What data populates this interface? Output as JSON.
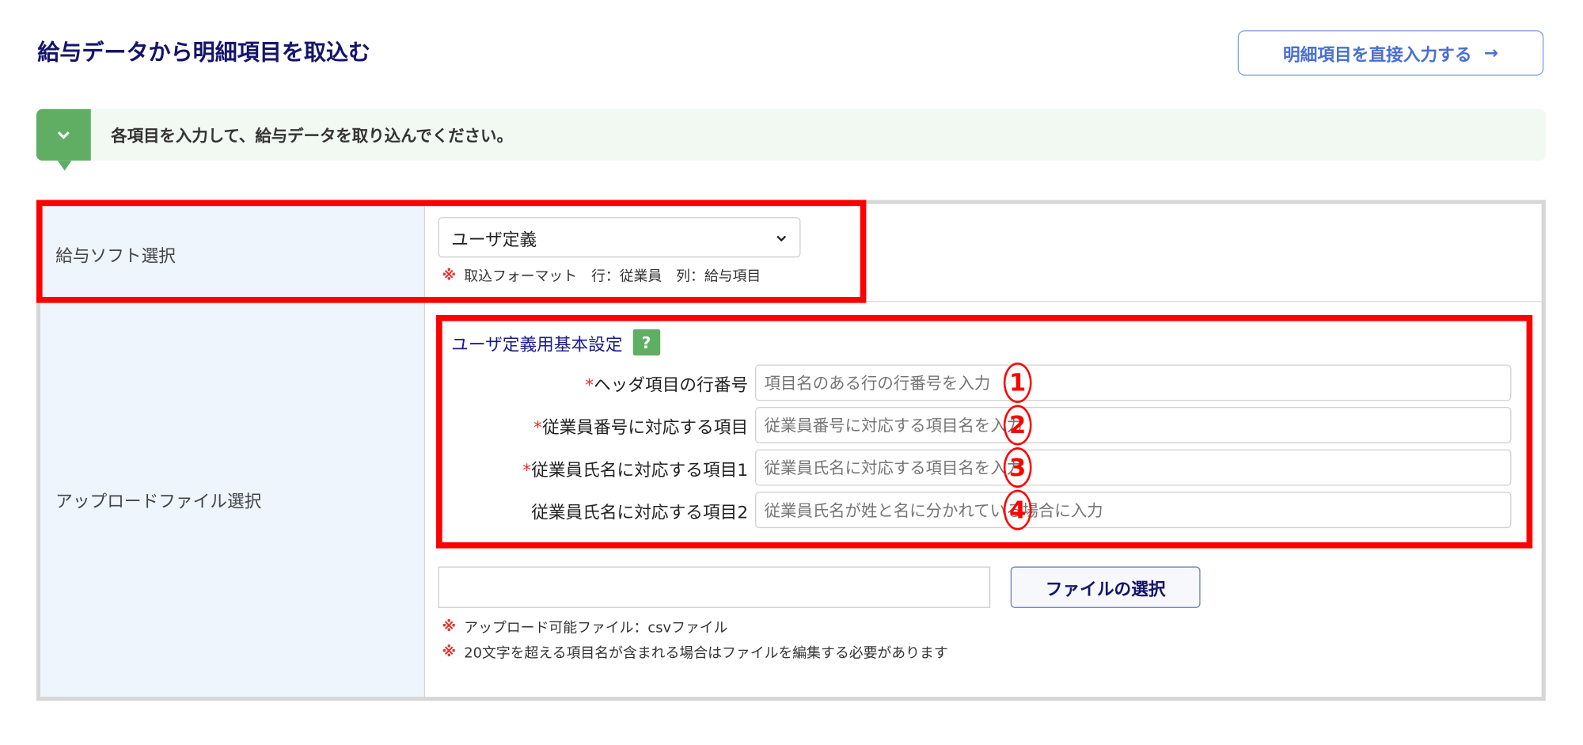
{
  "header": {
    "title": "給与データから明細項目を取込む",
    "direct_input_button": "明細項目を直接入力する",
    "arrow": "→"
  },
  "info": {
    "message": "各項目を入力して、給与データを取り込んでください。"
  },
  "rows": {
    "software": {
      "label": "給与ソフト選択",
      "selected": "ユーザ定義",
      "note": "取込フォーマット　行：従業員　列：給与項目"
    },
    "upload": {
      "label": "アップロードファイル選択",
      "section_title": "ユーザ定義用基本設定",
      "help": "?",
      "fields": [
        {
          "label": "ヘッダ項目の行番号",
          "required": "*",
          "placeholder": "項目名のある行の行番号を入力",
          "marker": "1"
        },
        {
          "label": "従業員番号に対応する項目",
          "required": "*",
          "placeholder": "従業員番号に対応する項目名を入力",
          "marker": "2"
        },
        {
          "label": "従業員氏名に対応する項目1",
          "required": "*",
          "placeholder": "従業員氏名に対応する項目名を入力",
          "marker": "3"
        },
        {
          "label": "従業員氏名に対応する項目2",
          "required": "",
          "placeholder": "従業員氏名が姓と名に分かれている場合に入力",
          "marker": "4"
        }
      ],
      "file_button": "ファイルの選択",
      "notes": [
        "アップロード可能ファイル：csvファイル",
        "20文字を超える項目名が含まれる場合はファイルを編集する必要があります"
      ]
    }
  },
  "kome": "※",
  "colors": {
    "accent_red": "#ff0000",
    "green": "#5fae64",
    "navy": "#15156b",
    "label_bg": "#eef5fd"
  }
}
